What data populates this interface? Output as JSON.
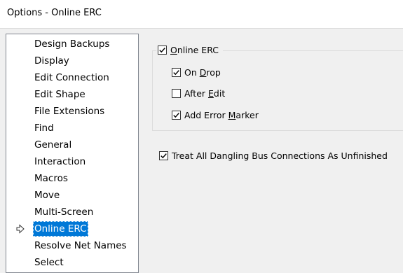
{
  "window": {
    "title": "Options - Online ERC"
  },
  "tree": {
    "items": [
      "Design Backups",
      "Display",
      "Edit Connection",
      "Edit Shape",
      "File Extensions",
      "Find",
      "General",
      "Interaction",
      "Macros",
      "Move",
      "Multi-Screen",
      "Online ERC",
      "Resolve Net Names",
      "Select"
    ],
    "selected_index": 11,
    "selected_icon": "arrow-right-icon"
  },
  "online_erc": {
    "enable": {
      "pre": "",
      "mnemonic": "O",
      "post": "nline ERC",
      "checked": true
    },
    "options": [
      {
        "pre": "On ",
        "mnemonic": "D",
        "post": "rop",
        "checked": true
      },
      {
        "pre": "After ",
        "mnemonic": "E",
        "post": "dit",
        "checked": false
      },
      {
        "pre": "Add Error ",
        "mnemonic": "M",
        "post": "arker",
        "checked": true
      }
    ]
  },
  "dangling": {
    "label": "Treat All Dangling Bus Connections As Unfinished",
    "checked": true
  },
  "colors": {
    "selection": "#0078d7",
    "background": "#f0f0f0"
  }
}
